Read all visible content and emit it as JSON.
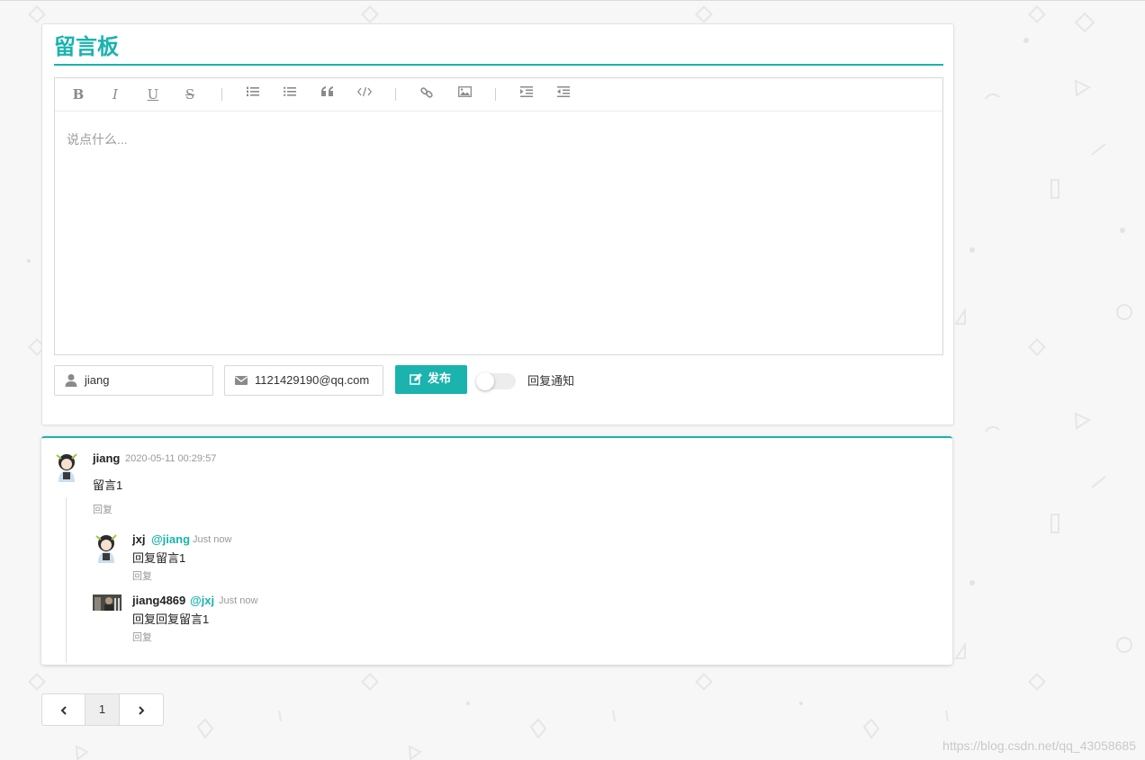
{
  "board": {
    "title": "留言板",
    "placeholder": "说点什么...",
    "toolbar": [
      "bold",
      "italic",
      "underline",
      "strikethrough",
      "ordered-list",
      "unordered-list",
      "quote",
      "code",
      "link",
      "image",
      "indent",
      "outdent"
    ],
    "name_value": "jiang",
    "email_value": "1121429190@qq.com",
    "publish_label": "发布",
    "notify_label": "回复通知",
    "notify_on": false
  },
  "comments": [
    {
      "user": "jiang",
      "time": "2020-05-11 00:29:57",
      "text": "留言1",
      "reply_label": "回复",
      "replies": [
        {
          "user": "jxj",
          "at": "@jiang",
          "time": "Just now",
          "text": "回复留言1",
          "reply_label": "回复"
        },
        {
          "user": "jiang4869",
          "at": "@jxj",
          "time": "Just now",
          "text": "回复回复留言1",
          "reply_label": "回复"
        }
      ]
    }
  ],
  "pagination": {
    "current": "1"
  },
  "watermark": "https://blog.csdn.net/qq_43058685",
  "colors": {
    "accent": "#1ab3ae",
    "background": "#f7f7f7"
  }
}
